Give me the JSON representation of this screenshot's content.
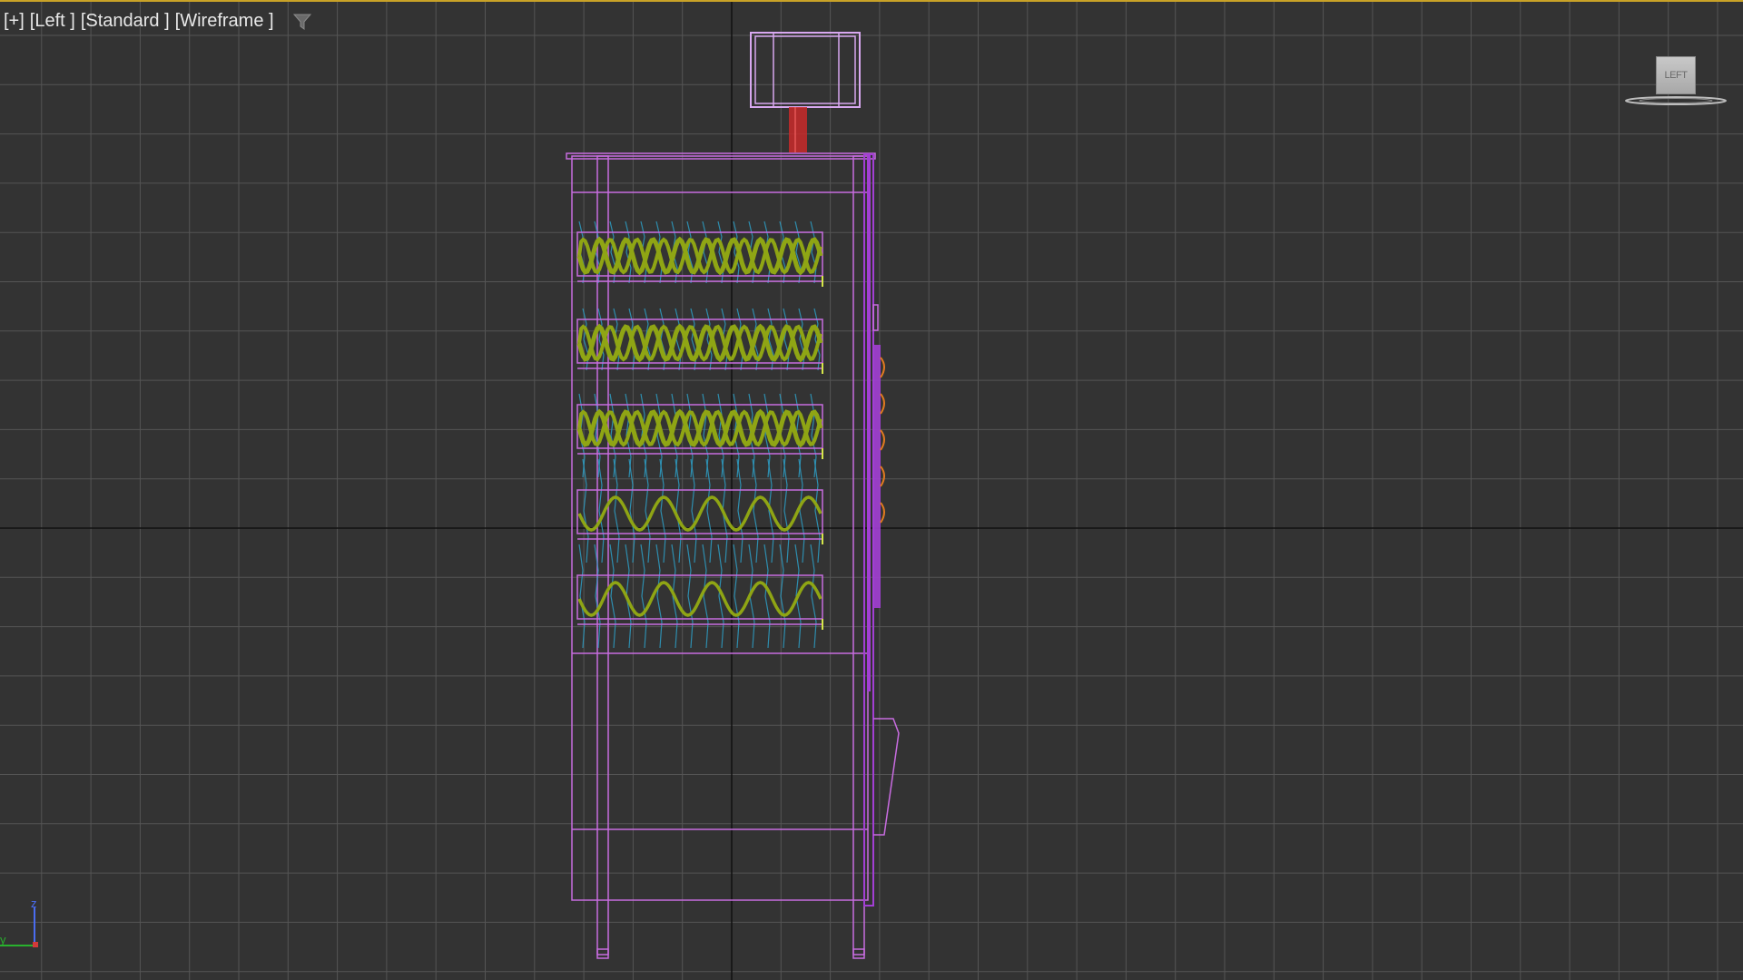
{
  "viewport": {
    "labels": [
      "[+]",
      "[Left ]",
      "[Standard ]",
      "[Wireframe ]"
    ],
    "filter_icon": "funnel-icon",
    "active_border_color": "#c9a227",
    "background_color": "#333333",
    "grid_color": "#555555",
    "axis_line_color": "#111111"
  },
  "viewcube": {
    "face_label": "LEFT",
    "icon": "viewcube-icon"
  },
  "axis_tripod": {
    "z_label": "z",
    "y_label": "y",
    "z_color": "#4a6cf0",
    "y_color": "#29b12e",
    "x_color": "#d23a3a"
  },
  "object_colors": {
    "frame": "#c86ce0",
    "door": "#a23fd4",
    "camera": "#d8a8f0",
    "camera_post": "#c92a2a",
    "coils": "#8fa514",
    "coils_light": "#d6e64a",
    "bottles": "#2e9ec4",
    "buttons": "#e07a20"
  }
}
